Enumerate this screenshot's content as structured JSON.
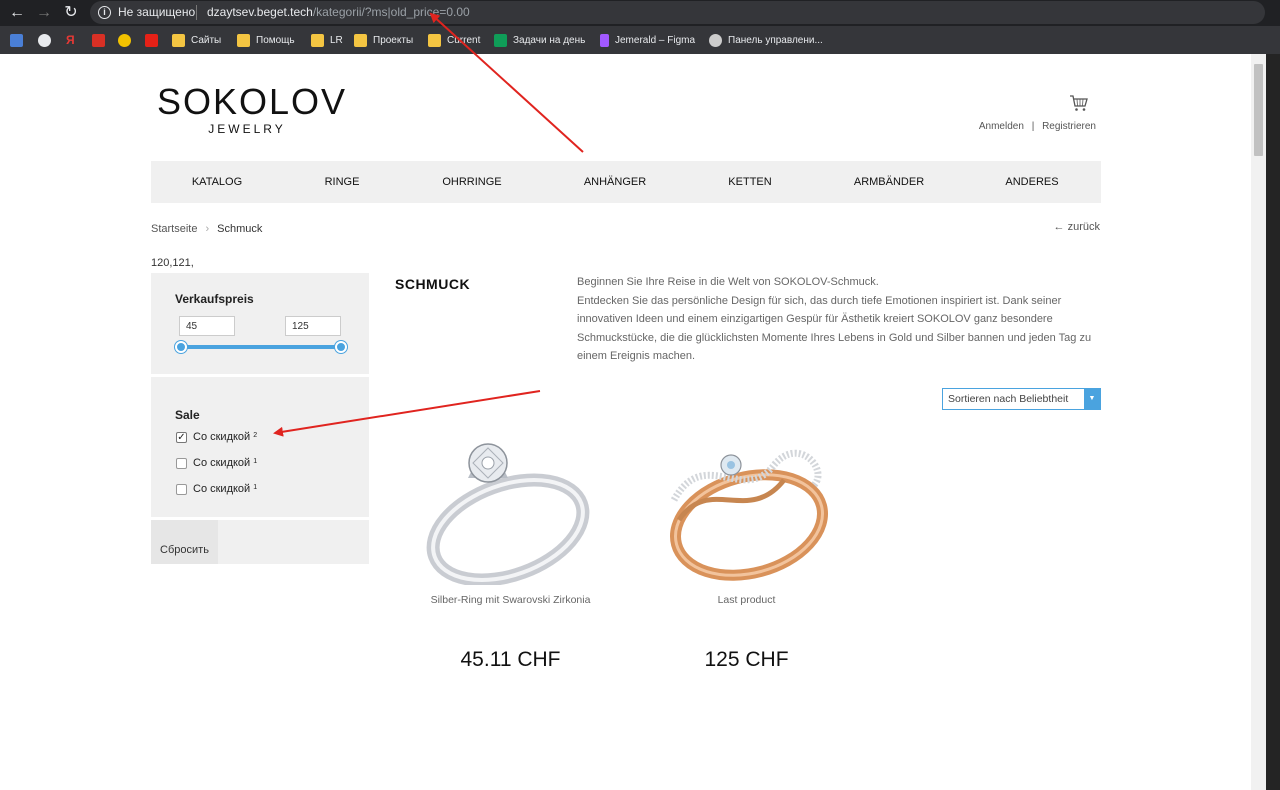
{
  "browser": {
    "security_label": "Не защищено",
    "url_host": "dzaytsev.beget.tech",
    "url_path": "/kategorii/?ms|old_price=0.00",
    "bookmarks": [
      "Сайты",
      "Помощь",
      "LR",
      "Проекты",
      "Current",
      "Задачи на день",
      "Jemerald – Figma",
      "Панель управлени..."
    ]
  },
  "site": {
    "logo_main": "SOKOLOV",
    "logo_sub": "JEWELRY",
    "account": {
      "login": "Anmelden",
      "separator": "|",
      "register": "Registrieren"
    },
    "nav": [
      "KATALOG",
      "RINGE",
      "OHRRINGE",
      "ANHÄNGER",
      "KETTEN",
      "ARMBÄNDER",
      "ANDERES"
    ],
    "breadcrumb": {
      "home": "Startseite",
      "current": "Schmuck"
    },
    "back_link": "← zurück",
    "debug_ids": "120,121,"
  },
  "filters": {
    "price": {
      "title": "Verkaufspreis",
      "min": "45",
      "max": "125"
    },
    "sale": {
      "title": "Sale",
      "options": [
        {
          "label": "Со скидкой",
          "count": "2",
          "checked": true
        },
        {
          "label": "Со скидкой",
          "count": "1",
          "checked": false
        },
        {
          "label": "Со скидкой",
          "count": "1",
          "checked": false
        }
      ]
    },
    "reset_label": "Сбросить"
  },
  "category": {
    "title": "SCHMUCK",
    "description": "Beginnen Sie Ihre Reise in die Welt von SOKOLOV-Schmuck.\nEntdecken Sie das persönliche Design für sich, das durch tiefe Emotionen inspiriert ist. Dank seiner innovativen Ideen und einem einzigartigen Gespür für Ästhetik kreiert SOKOLOV ganz besondere Schmuckstücke, die die glücklichsten Momente Ihres Lebens in Gold und Silber bannen und jeden Tag zu einem Ereignis machen.",
    "sort_label": "Sortieren nach Beliebtheit"
  },
  "products": [
    {
      "name": "Silber-Ring mit Swarovski Zirkonia",
      "price": "45.11 CHF"
    },
    {
      "name": "Last product",
      "price": "125 CHF"
    }
  ],
  "colors": {
    "accent": "#4aa3df",
    "annotation": "#e0241f"
  }
}
